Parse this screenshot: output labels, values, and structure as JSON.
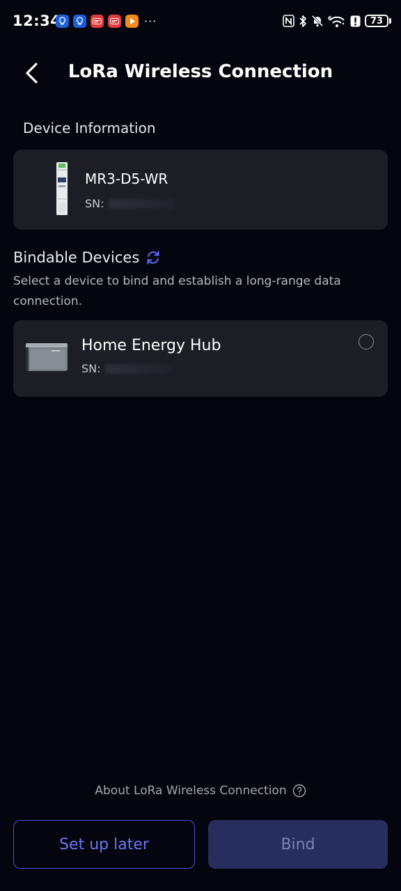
{
  "status_bar": {
    "time": "12:34",
    "notification_icons": [
      "idea-bulb-icon",
      "idea-bulb-icon",
      "news-app-icon",
      "news-app-icon",
      "play-icon"
    ],
    "more": "···",
    "battery": "73",
    "nfc_label": "N",
    "wifi_label": "6"
  },
  "header": {
    "title": "LoRa Wireless Connection"
  },
  "device_info": {
    "section_label": "Device Information",
    "name": "MR3-D5-WR",
    "sn_label": "SN:"
  },
  "bindable": {
    "title": "Bindable Devices",
    "description": "Select a device to bind and establish a long-range data connection.",
    "devices": [
      {
        "name": "Home Energy Hub",
        "sn_label": "SN:",
        "selected": false
      }
    ]
  },
  "footer": {
    "about_label": "About LoRa Wireless Connection",
    "setup_later_label": "Set up later",
    "bind_label": "Bind"
  },
  "colors": {
    "background": "#05050f",
    "card": "#1d1d26",
    "accent": "#4754d6",
    "bind_disabled": "#272d5c"
  }
}
